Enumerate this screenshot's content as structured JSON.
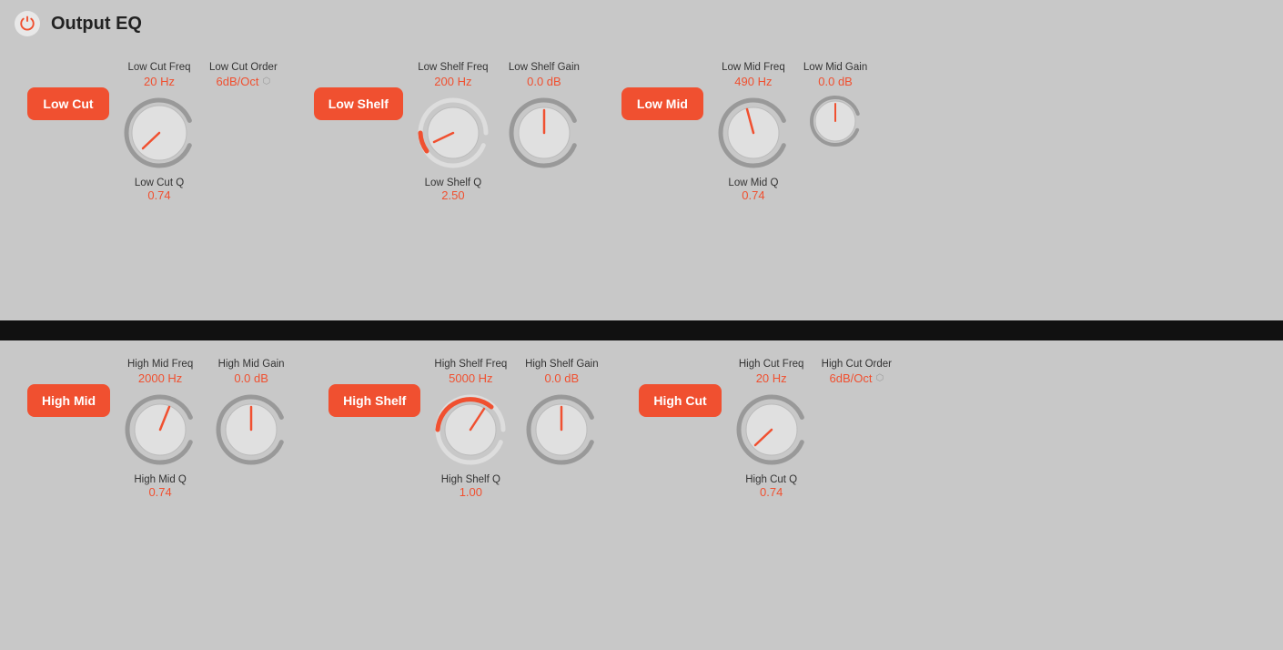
{
  "app": {
    "title": "Output EQ"
  },
  "top_section": {
    "bands": [
      {
        "id": "low-cut",
        "button_label": "Low Cut",
        "controls": [
          {
            "id": "low-cut-freq",
            "label": "Low Cut Freq",
            "value": "20 Hz",
            "knob_rotation": -130,
            "has_arc": true,
            "arc_start": -130,
            "arc_end": -130,
            "size": "large"
          },
          {
            "id": "low-cut-order",
            "label": "Low Cut Order",
            "value": "6dB/Oct",
            "has_stepper": true,
            "size": "none"
          }
        ],
        "q_label": "Low Cut Q",
        "q_value": "0.74"
      },
      {
        "id": "low-shelf",
        "button_label": "Low Shelf",
        "controls": [
          {
            "id": "low-shelf-freq",
            "label": "Low Shelf Freq",
            "value": "200 Hz",
            "knob_rotation": -60,
            "size": "large",
            "arc_color": "#f05030"
          },
          {
            "id": "low-shelf-gain",
            "label": "Low Shelf Gain",
            "value": "0.0 dB",
            "knob_rotation": 90,
            "size": "large"
          }
        ],
        "q_label": "Low Shelf Q",
        "q_value": "2.50"
      },
      {
        "id": "low-mid",
        "button_label": "Low Mid",
        "controls": [
          {
            "id": "low-mid-freq",
            "label": "Low Mid Freq",
            "value": "490 Hz",
            "knob_rotation": -20,
            "size": "large"
          },
          {
            "id": "low-mid-gain",
            "label": "Low Mid Gain",
            "value": "0.0 dB",
            "knob_rotation": 90,
            "size": "medium"
          }
        ],
        "q_label": "Low Mid Q",
        "q_value": "0.74"
      }
    ]
  },
  "bottom_section": {
    "bands": [
      {
        "id": "high-mid",
        "button_label": "High Mid",
        "controls": [
          {
            "id": "high-mid-freq",
            "label": "High Mid Freq",
            "value": "2000 Hz",
            "knob_rotation": -20,
            "size": "large"
          },
          {
            "id": "high-mid-gain",
            "label": "High Mid Gain",
            "value": "0.0 dB",
            "knob_rotation": 90,
            "size": "large"
          }
        ],
        "q_label": "High Mid Q",
        "q_value": "0.74"
      },
      {
        "id": "high-shelf",
        "button_label": "High Shelf",
        "controls": [
          {
            "id": "high-shelf-freq",
            "label": "High Shelf Freq",
            "value": "5000 Hz",
            "knob_rotation": 30,
            "size": "large",
            "arc_color": "#f05030"
          },
          {
            "id": "high-shelf-gain",
            "label": "High Shelf Gain",
            "value": "0.0 dB",
            "knob_rotation": 90,
            "size": "large"
          }
        ],
        "q_label": "High Shelf Q",
        "q_value": "1.00"
      },
      {
        "id": "high-cut",
        "button_label": "High Cut",
        "controls": [
          {
            "id": "high-cut-freq",
            "label": "High Cut Freq",
            "value": "20 Hz",
            "knob_rotation": -130,
            "size": "large"
          },
          {
            "id": "high-cut-order",
            "label": "High Cut Order",
            "value": "6dB/Oct",
            "has_stepper": true,
            "size": "none"
          }
        ],
        "q_label": "High Cut Q",
        "q_value": "0.74"
      }
    ]
  }
}
